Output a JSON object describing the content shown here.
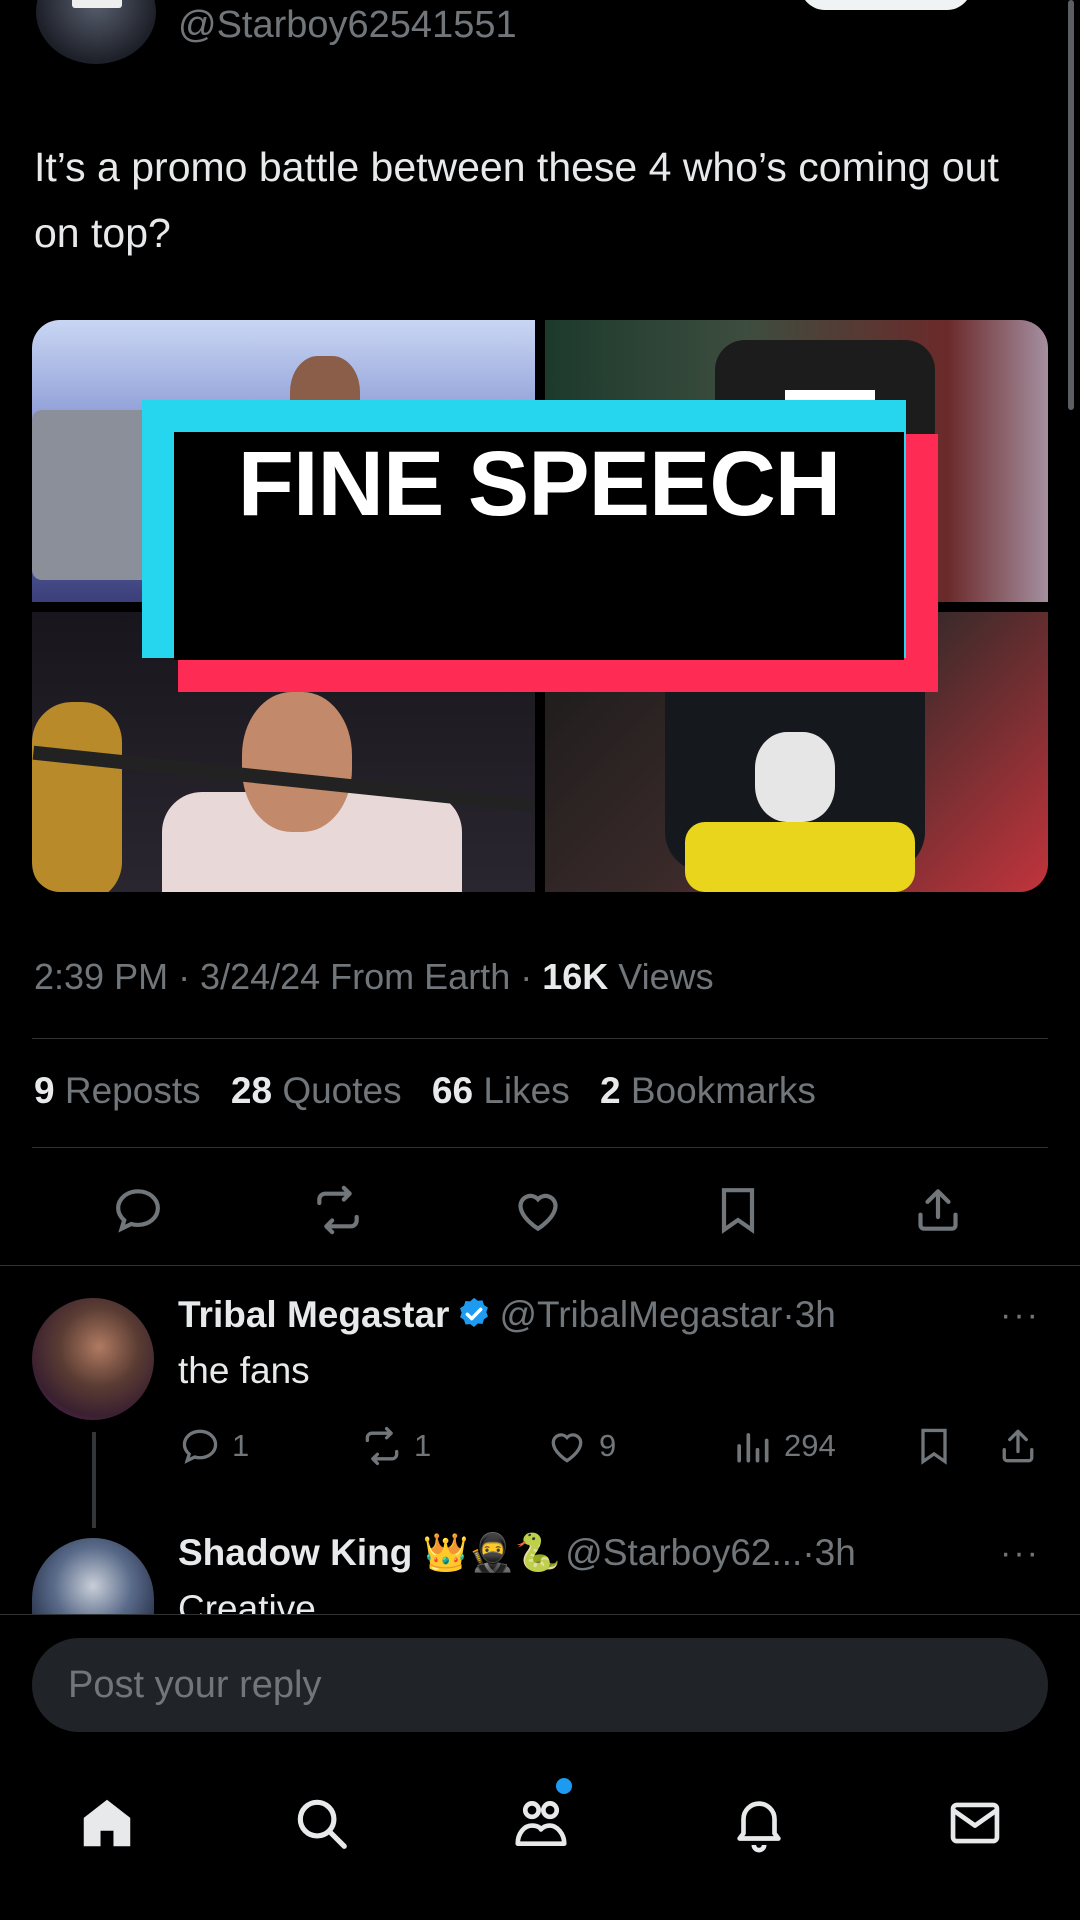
{
  "author": {
    "handle": "@Starboy62541551",
    "avatar_text": "rko"
  },
  "tweet": {
    "text": "It’s a promo battle between these 4 who’s coming out on top?"
  },
  "overlay": {
    "text": "FINE SPEECH"
  },
  "meta": {
    "time_date": "2:39 PM · 3/24/24 From Earth · ",
    "views_count": "16K",
    "views_label": " Views"
  },
  "stats": {
    "reposts_count": "9",
    "reposts_label": "Reposts",
    "quotes_count": "28",
    "quotes_label": "Quotes",
    "likes_count": "66",
    "likes_label": "Likes",
    "bookmarks_count": "2",
    "bookmarks_label": "Bookmarks"
  },
  "replies": [
    {
      "name": "Tribal Megastar",
      "verified": true,
      "handle": "@TribalMegastar",
      "time": "·3h",
      "body": "the fans",
      "reply_count": "1",
      "repost_count": "1",
      "like_count": "9",
      "view_count": "294"
    },
    {
      "name": "Shadow King 👑🥷🐍",
      "handle": "@Starboy62...",
      "time": "·3h",
      "body": "Creative"
    }
  ],
  "more_label": "···",
  "reply_input": {
    "placeholder": "Post your reply"
  },
  "colors": {
    "accent": "#1d9bf0",
    "overlay_cyan": "#25d6ee",
    "overlay_red": "#fe2c55"
  },
  "icons": {
    "actions": [
      "reply-icon",
      "repost-icon",
      "like-icon",
      "bookmark-icon",
      "share-icon"
    ],
    "nav": [
      "home-icon",
      "search-icon",
      "communities-icon",
      "notifications-icon",
      "messages-icon"
    ]
  }
}
